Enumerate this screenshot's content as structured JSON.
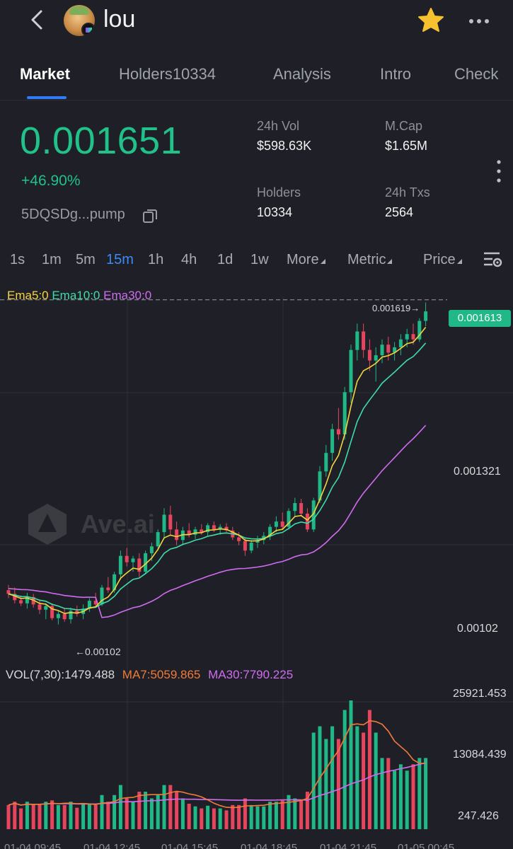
{
  "header": {
    "token_name": "lou"
  },
  "tabs": [
    {
      "label": "Market"
    },
    {
      "label": "Holders10334"
    },
    {
      "label": "Analysis"
    },
    {
      "label": "Intro"
    },
    {
      "label": "Check"
    }
  ],
  "summary": {
    "price": "0.001651",
    "change": "+46.90%",
    "address": "5DQSDg...pump"
  },
  "stats": {
    "vol_label": "24h Vol",
    "vol_value": "$598.63K",
    "mcap_label": "M.Cap",
    "mcap_value": "$1.65M",
    "holders_label": "Holders",
    "holders_value": "10334",
    "txs_label": "24h Txs",
    "txs_value": "2564"
  },
  "timeframes": [
    "1s",
    "1m",
    "5m",
    "15m",
    "1h",
    "4h",
    "1d",
    "1w"
  ],
  "timeframe_selected": "15m",
  "dropdowns": {
    "more": "More",
    "metric": "Metric",
    "price": "Price"
  },
  "indicators": {
    "ema5": "Ema5:0",
    "ema10": "Ema10:0",
    "ema30": "Ema30:0",
    "vol": "VOL(7,30):1479.488",
    "ma7": "MA7:5059.865",
    "ma30": "MA30:7790.225"
  },
  "price_axis": {
    "last_price": "0.001613",
    "high_marker": "0.001619→",
    "low_marker": "←0.00102",
    "tick_mid": "0.001321",
    "tick_low": "0.00102"
  },
  "volume_axis": {
    "max": "25921.453",
    "mid": "13084.439",
    "min": "247.426"
  },
  "watermark": "Ave.ai",
  "time_axis": [
    "01-04 09:45",
    "01-04 12:45",
    "01-04 15:45",
    "01-04 18:45",
    "01-04 21:45",
    "01-05 00:45"
  ],
  "colors": {
    "up": "#1fb886",
    "down": "#e5465d",
    "ema5": "#f5d43c",
    "ema10": "#3fdca8",
    "ema30": "#d16bf0",
    "ma7": "#f07a3a",
    "ma30": "#d16bf0",
    "accent": "#2f7cf6"
  },
  "chart_data": {
    "type": "candlestick",
    "price_range": [
      0.00097,
      0.00164
    ],
    "candles_ohlc": [
      [
        0.001085,
        0.001095,
        0.00107,
        0.001078
      ],
      [
        0.001078,
        0.00109,
        0.00106,
        0.001066
      ],
      [
        0.001066,
        0.001075,
        0.001055,
        0.00106
      ],
      [
        0.00106,
        0.00108,
        0.00105,
        0.001072
      ],
      [
        0.001072,
        0.001078,
        0.001052,
        0.001058
      ],
      [
        0.001058,
        0.001066,
        0.00104,
        0.001048
      ],
      [
        0.001048,
        0.00106,
        0.00103,
        0.001055
      ],
      [
        0.001055,
        0.00106,
        0.001028,
        0.001032
      ],
      [
        0.001032,
        0.001045,
        0.00102,
        0.00104
      ],
      [
        0.00104,
        0.00105,
        0.001025,
        0.00103
      ],
      [
        0.00103,
        0.001052,
        0.001022,
        0.001046
      ],
      [
        0.001046,
        0.001056,
        0.001035,
        0.00104
      ],
      [
        0.00104,
        0.001058,
        0.00103,
        0.00105
      ],
      [
        0.00105,
        0.00107,
        0.001044,
        0.001065
      ],
      [
        0.001065,
        0.00108,
        0.001055,
        0.001058
      ],
      [
        0.001058,
        0.001095,
        0.001055,
        0.00109
      ],
      [
        0.00109,
        0.00111,
        0.00108,
        0.001085
      ],
      [
        0.001085,
        0.00112,
        0.00108,
        0.001115
      ],
      [
        0.001115,
        0.00116,
        0.001105,
        0.00115
      ],
      [
        0.00115,
        0.001165,
        0.00113,
        0.001138
      ],
      [
        0.001138,
        0.00115,
        0.00112,
        0.001145
      ],
      [
        0.001145,
        0.001155,
        0.00111,
        0.00112
      ],
      [
        0.00112,
        0.00116,
        0.001115,
        0.001155
      ],
      [
        0.001155,
        0.001175,
        0.00114,
        0.001168
      ],
      [
        0.001168,
        0.0012,
        0.00116,
        0.001195
      ],
      [
        0.001195,
        0.00124,
        0.001185,
        0.001228
      ],
      [
        0.001228,
        0.001245,
        0.00119,
        0.0012
      ],
      [
        0.0012,
        0.001215,
        0.00117,
        0.00118
      ],
      [
        0.00118,
        0.001205,
        0.00117,
        0.001198
      ],
      [
        0.001198,
        0.001212,
        0.001185,
        0.00119
      ],
      [
        0.00119,
        0.001205,
        0.001182,
        0.0012
      ],
      [
        0.0012,
        0.00121,
        0.00119,
        0.001195
      ],
      [
        0.001195,
        0.001212,
        0.001188,
        0.001208
      ],
      [
        0.001208,
        0.001215,
        0.001195,
        0.0012
      ],
      [
        0.0012,
        0.00121,
        0.00119,
        0.001205
      ],
      [
        0.001205,
        0.001212,
        0.001195,
        0.001198
      ],
      [
        0.001198,
        0.001205,
        0.00118,
        0.001185
      ],
      [
        0.001185,
        0.001195,
        0.00117,
        0.001178
      ],
      [
        0.001178,
        0.001185,
        0.00115,
        0.00116
      ],
      [
        0.00116,
        0.00118,
        0.001155,
        0.001175
      ],
      [
        0.001175,
        0.001188,
        0.001165,
        0.00118
      ],
      [
        0.00118,
        0.001195,
        0.001172,
        0.001188
      ],
      [
        0.001188,
        0.00121,
        0.00118,
        0.001205
      ],
      [
        0.001205,
        0.001225,
        0.001195,
        0.001215
      ],
      [
        0.001215,
        0.001232,
        0.0012,
        0.001205
      ],
      [
        0.001205,
        0.00124,
        0.0012,
        0.001235
      ],
      [
        0.001235,
        0.00126,
        0.001225,
        0.00125
      ],
      [
        0.00125,
        0.001258,
        0.001225,
        0.00123
      ],
      [
        0.00123,
        0.00124,
        0.001195,
        0.0012
      ],
      [
        0.0012,
        0.00126,
        0.001195,
        0.001255
      ],
      [
        0.001255,
        0.00132,
        0.00125,
        0.00131
      ],
      [
        0.00131,
        0.00136,
        0.0013,
        0.001345
      ],
      [
        0.001345,
        0.0014,
        0.00133,
        0.00139
      ],
      [
        0.00139,
        0.00143,
        0.00137,
        0.00138
      ],
      [
        0.00138,
        0.00147,
        0.00137,
        0.00146
      ],
      [
        0.00146,
        0.00155,
        0.00144,
        0.00154
      ],
      [
        0.00154,
        0.00159,
        0.00152,
        0.001575
      ],
      [
        0.001575,
        0.00159,
        0.001525,
        0.00154
      ],
      [
        0.00154,
        0.00156,
        0.0015,
        0.00152
      ],
      [
        0.00152,
        0.001545,
        0.00148,
        0.00153
      ],
      [
        0.00153,
        0.00156,
        0.001515,
        0.00155
      ],
      [
        0.00155,
        0.001565,
        0.00152,
        0.001535
      ],
      [
        0.001535,
        0.001555,
        0.00152,
        0.001545
      ],
      [
        0.001545,
        0.00157,
        0.00153,
        0.00156
      ],
      [
        0.00156,
        0.00158,
        0.001545,
        0.00157
      ],
      [
        0.00157,
        0.00159,
        0.00155,
        0.00156
      ],
      [
        0.00156,
        0.0016,
        0.001555,
        0.001595
      ],
      [
        0.001595,
        0.00163,
        0.001585,
        0.001613
      ]
    ],
    "volume_range": [
      0,
      25921.453
    ]
  }
}
